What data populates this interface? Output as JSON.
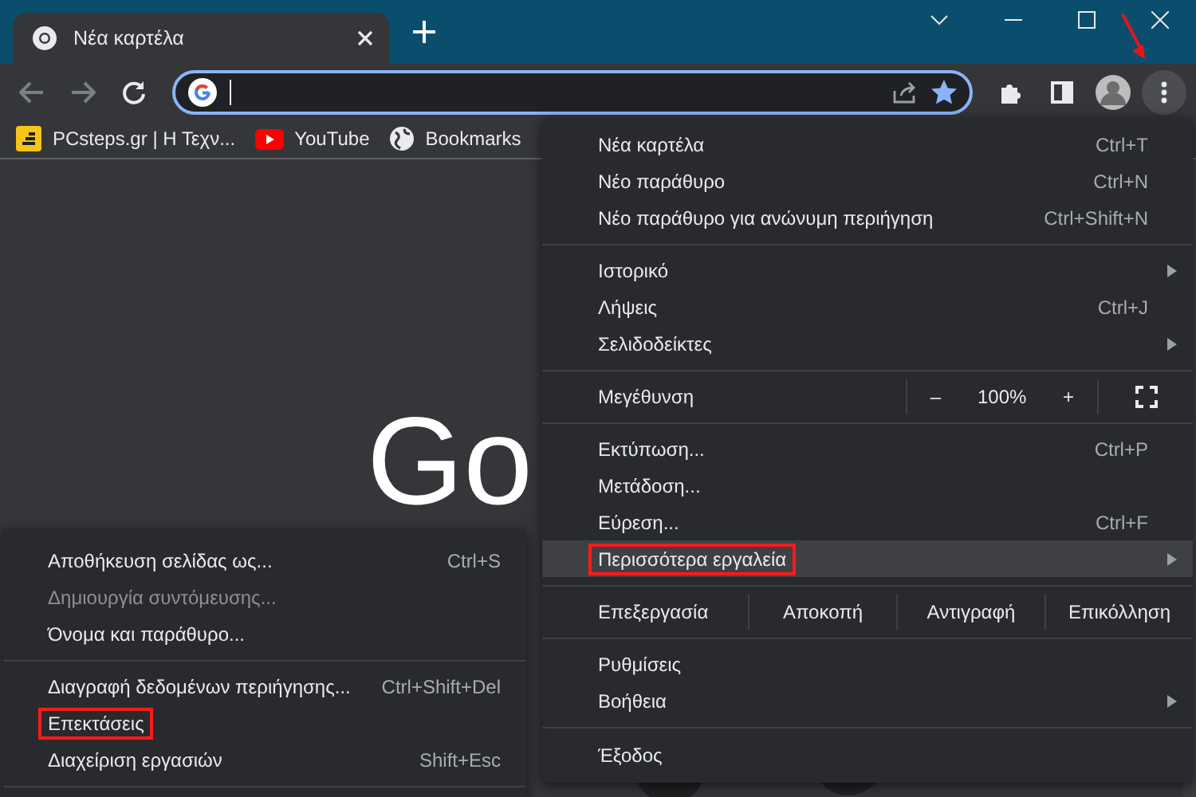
{
  "tab": {
    "title": "Νέα καρτέλα",
    "selected": true
  },
  "toolbar": {
    "menu_annotated": true
  },
  "bookmarks": [
    {
      "kind": "pcsteps",
      "label": "PCsteps.gr | Η Τεχν..."
    },
    {
      "kind": "youtube",
      "label": "YouTube"
    },
    {
      "kind": "globe",
      "label": "Bookmarks"
    }
  ],
  "page": {
    "logo_text": "Go"
  },
  "menu": {
    "items": [
      {
        "kind": "item",
        "label": "Νέα καρτέλα",
        "shortcut": "Ctrl+T",
        "submenu": false,
        "highlighted": false,
        "annotated": false
      },
      {
        "kind": "item",
        "label": "Νέο παράθυρο",
        "shortcut": "Ctrl+N",
        "submenu": false,
        "highlighted": false,
        "annotated": false
      },
      {
        "kind": "item",
        "label": "Νέο παράθυρο για ανώνυμη περιήγηση",
        "shortcut": "Ctrl+Shift+N",
        "submenu": false,
        "highlighted": false,
        "annotated": false
      },
      {
        "kind": "separator"
      },
      {
        "kind": "item",
        "label": "Ιστορικό",
        "submenu": true,
        "highlighted": false,
        "annotated": false
      },
      {
        "kind": "item",
        "label": "Λήψεις",
        "shortcut": "Ctrl+J",
        "submenu": false,
        "highlighted": false,
        "annotated": false
      },
      {
        "kind": "item",
        "label": "Σελιδοδείκτες",
        "submenu": true,
        "highlighted": false,
        "annotated": false
      },
      {
        "kind": "separator"
      },
      {
        "kind": "zoom",
        "label": "Μεγέθυνση",
        "minus": "–",
        "value": "100%",
        "plus": "+"
      },
      {
        "kind": "separator"
      },
      {
        "kind": "item",
        "label": "Εκτύπωση...",
        "shortcut": "Ctrl+P",
        "submenu": false,
        "highlighted": false,
        "annotated": false
      },
      {
        "kind": "item",
        "label": "Μετάδοση...",
        "submenu": false,
        "highlighted": false,
        "annotated": false
      },
      {
        "kind": "item",
        "label": "Εύρεση...",
        "shortcut": "Ctrl+F",
        "submenu": false,
        "highlighted": false,
        "annotated": false
      },
      {
        "kind": "item",
        "label": "Περισσότερα εργαλεία",
        "submenu": true,
        "highlighted": true,
        "annotated": true
      },
      {
        "kind": "separator"
      },
      {
        "kind": "edit",
        "label": "Επεξεργασία",
        "buttons": [
          "Αποκοπή",
          "Αντιγραφή",
          "Επικόλληση"
        ]
      },
      {
        "kind": "separator"
      },
      {
        "kind": "item",
        "label": "Ρυθμίσεις",
        "submenu": false,
        "highlighted": false,
        "annotated": false
      },
      {
        "kind": "item",
        "label": "Βοήθεια",
        "submenu": true,
        "highlighted": false,
        "annotated": false
      },
      {
        "kind": "separator"
      },
      {
        "kind": "item",
        "label": "Έξοδος",
        "submenu": false,
        "highlighted": false,
        "annotated": false
      }
    ]
  },
  "submenu": {
    "items": [
      {
        "kind": "item",
        "label": "Αποθήκευση σελίδας ως...",
        "shortcut": "Ctrl+S",
        "disabled": false,
        "annotated": false
      },
      {
        "kind": "item",
        "label": "Δημιουργία συντόμευσης...",
        "disabled": true,
        "annotated": false
      },
      {
        "kind": "item",
        "label": "Όνομα και παράθυρο...",
        "disabled": false,
        "annotated": false
      },
      {
        "kind": "separator"
      },
      {
        "kind": "item",
        "label": "Διαγραφή δεδομένων περιήγησης...",
        "shortcut": "Ctrl+Shift+Del",
        "disabled": false,
        "annotated": false
      },
      {
        "kind": "item",
        "label": "Επεκτάσεις",
        "disabled": false,
        "annotated": true
      },
      {
        "kind": "item",
        "label": "Διαχείριση εργασιών",
        "shortcut": "Shift+Esc",
        "disabled": false,
        "annotated": false
      },
      {
        "kind": "separator"
      }
    ]
  }
}
